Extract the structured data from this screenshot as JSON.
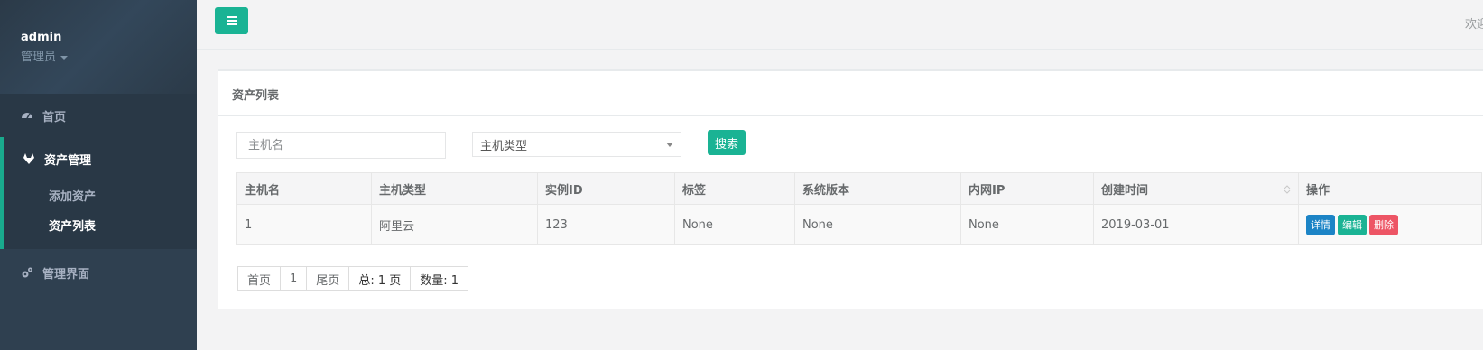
{
  "profile": {
    "name": "admin",
    "role": "管理员"
  },
  "sidebar": {
    "home": "首页",
    "asset_mgmt": "资产管理",
    "sub_items": [
      "添加资产",
      "资产列表"
    ],
    "admin_ui": "管理界面"
  },
  "topbar": {
    "welcome": "欢迎"
  },
  "panel": {
    "title": "资产列表"
  },
  "search": {
    "hostname_placeholder": "主机名",
    "type_select_value": "主机类型",
    "search_button": "搜索"
  },
  "table": {
    "headers": [
      "主机名",
      "主机类型",
      "实例ID",
      "标签",
      "系统版本",
      "内网IP",
      "创建时间",
      "操作"
    ],
    "rows": [
      {
        "hostname": "1",
        "type": "阿里云",
        "instance_id": "123",
        "tag": "None",
        "os_version": "None",
        "private_ip": "None",
        "created": "2019-03-01"
      }
    ],
    "actions": {
      "detail": "详情",
      "edit": "编辑",
      "delete": "删除"
    }
  },
  "pagination": {
    "first": "首页",
    "page": "1",
    "last": "尾页",
    "total": "总: 1 页",
    "count": "数量: 1"
  },
  "colors": {
    "sidebar_bg": "#2f4050",
    "accent": "#1ab394",
    "detail_btn": "#1c84c6",
    "delete_btn": "#ed5565"
  }
}
